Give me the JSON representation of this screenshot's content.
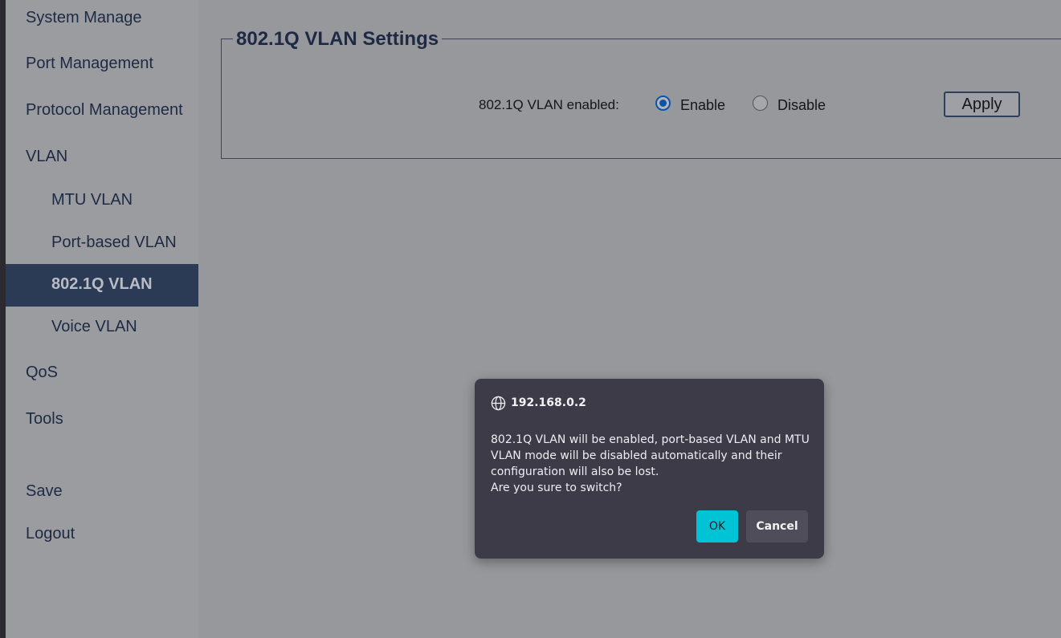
{
  "sidebar": {
    "items": [
      {
        "label": "System Manage"
      },
      {
        "label": "Port Management"
      },
      {
        "label": "Protocol Management"
      },
      {
        "label": "VLAN"
      },
      {
        "label": "MTU VLAN"
      },
      {
        "label": "Port-based VLAN"
      },
      {
        "label": "802.1Q VLAN"
      },
      {
        "label": "Voice VLAN"
      },
      {
        "label": "QoS"
      },
      {
        "label": "Tools"
      },
      {
        "label": "Save"
      },
      {
        "label": "Logout"
      }
    ],
    "active_item": "802.1Q VLAN"
  },
  "main": {
    "section_title": "802.1Q VLAN Settings",
    "enabled_label": "802.1Q VLAN enabled:",
    "options": [
      {
        "label": "Enable",
        "checked": true
      },
      {
        "label": "Disable",
        "checked": false
      }
    ],
    "apply_label": "Apply"
  },
  "dialog": {
    "origin": "192.168.0.2",
    "message_lines": [
      "802.1Q VLAN will be enabled, port-based VLAN and MTU",
      "VLAN mode will be disabled automatically and their",
      "configuration will also be lost.",
      "Are you sure to switch?"
    ],
    "ok_label": "OK",
    "cancel_label": "Cancel",
    "icon": "globe-icon"
  },
  "colors": {
    "sidebar_active_bg": "#2b3a55",
    "nav_text": "#1e2a44",
    "dialog_bg": "#3c3b47",
    "ok_button": "#00c4d6",
    "radio_selected": "#0b55a8"
  }
}
